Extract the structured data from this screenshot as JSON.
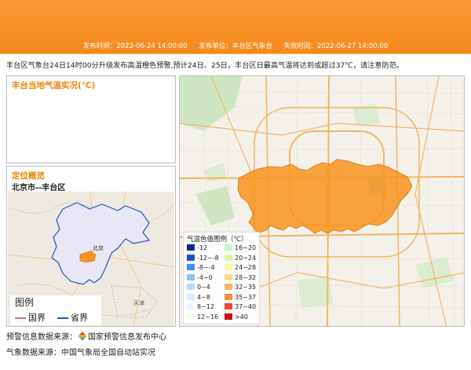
{
  "header": {
    "issue_time": "发布时间：2022-06-24 14:00:00",
    "issuer": "发布单位：丰台区气象台",
    "expire_time": "失效时间：2022-06-27 14:00:00"
  },
  "description": "丰台区气象台24日14时00分升级发布高温橙色预警,预计24日、25日，丰台区日最高气温将达到或超过37℃，请注意防范。",
  "temp_panel": {
    "title": "丰台当地气温实况(℃)"
  },
  "location_panel": {
    "title": "定位概览",
    "subtitle": "北京市--丰台区",
    "inset_labels": {
      "beijing": "北京",
      "tianjin": "天津"
    },
    "legend": {
      "title": "图例",
      "items": [
        {
          "label": "国界",
          "color": "#c8797a"
        },
        {
          "label": "省界",
          "color": "#1f55c8"
        }
      ]
    }
  },
  "map": {
    "warning_color": "#f7941d",
    "legend": {
      "title": "气温色值图例（℃）",
      "items": [
        {
          "label": "-12",
          "color": "#0d2a8c"
        },
        {
          "label": "16~20",
          "color": "#c9f5c0"
        },
        {
          "label": "-12~-8",
          "color": "#1f52c8"
        },
        {
          "label": "20~24",
          "color": "#ddf79f"
        },
        {
          "label": "-8~-4",
          "color": "#3f8ef0"
        },
        {
          "label": "24~28",
          "color": "#fbf3a6"
        },
        {
          "label": "-4~0",
          "color": "#86c3f5"
        },
        {
          "label": "28~32",
          "color": "#fbd98c"
        },
        {
          "label": "0~4",
          "color": "#b7ddf8"
        },
        {
          "label": "32~35",
          "color": "#f7b46b"
        },
        {
          "label": "4~8",
          "color": "#d8ecfb"
        },
        {
          "label": "35~37",
          "color": "#f48a47"
        },
        {
          "label": "8~12",
          "color": "#e9f6fd"
        },
        {
          "label": "37~40",
          "color": "#e8482c"
        },
        {
          "label": "12~16",
          "color": "#f2fbef"
        },
        {
          "label": ">40",
          "color": "#c6101b"
        }
      ]
    }
  },
  "footer": {
    "warning_source_label": "预警信息数据来源：",
    "warning_source": "国家预警信息发布中心",
    "weather_source": "气象数据来源：中国气象局全国自动站实况"
  }
}
